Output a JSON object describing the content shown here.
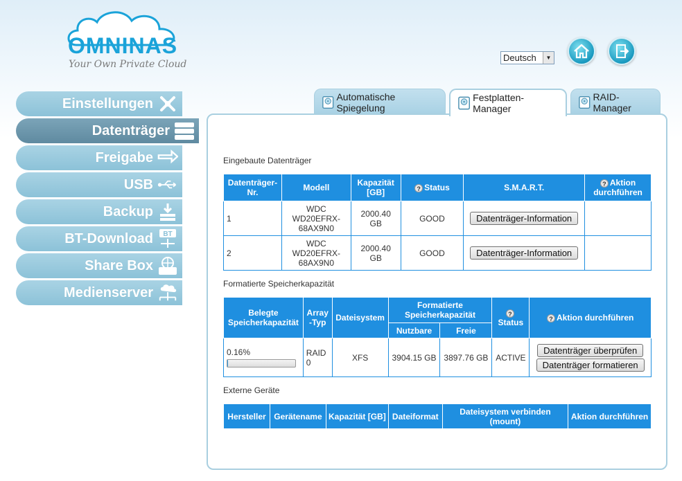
{
  "header": {
    "brand": "OMNINAS",
    "tagline": "Your Own Private Cloud",
    "language": "Deutsch"
  },
  "sidebar": {
    "items": [
      {
        "label": "Einstellungen",
        "icon": "tools-icon"
      },
      {
        "label": "Datenträger",
        "icon": "disk-stack-icon",
        "active": true
      },
      {
        "label": "Freigabe",
        "icon": "share-arrows-icon"
      },
      {
        "label": "USB",
        "icon": "usb-icon"
      },
      {
        "label": "Backup",
        "icon": "backup-icon"
      },
      {
        "label": "BT-Download",
        "icon": "bt-download-icon",
        "badge": "BT"
      },
      {
        "label": "Share Box",
        "icon": "share-box-icon"
      },
      {
        "label": "Medienserver",
        "icon": "media-server-icon"
      }
    ]
  },
  "tabs": [
    {
      "label": "Automatische Spiegelung"
    },
    {
      "label": "Festplatten-Manager",
      "active": true
    },
    {
      "label": "RAID-Manager"
    }
  ],
  "builtin": {
    "title": "Eingebaute Datenträger",
    "headers": {
      "nr": "Datenträger-Nr.",
      "model": "Modell",
      "capacity": "Kapazität [GB]",
      "status": "Status",
      "smart": "S.M.A.R.T.",
      "action": "Aktion durchführen"
    },
    "rows": [
      {
        "nr": "1",
        "model": "WDC WD20EFRX-68AX9N0",
        "capacity": "2000.40 GB",
        "status": "GOOD",
        "smart_button": "Datenträger-Information",
        "action": ""
      },
      {
        "nr": "2",
        "model": "WDC WD20EFRX-68AX9N0",
        "capacity": "2000.40 GB",
        "status": "GOOD",
        "smart_button": "Datenträger-Information",
        "action": ""
      }
    ]
  },
  "formatted": {
    "title": "Formatierte Speicherkapazität",
    "headers": {
      "used": "Belegte Speicherkapazität",
      "array": "Array -Typ",
      "fs": "Dateisystem",
      "formatted": "Formatierte Speicherkapazität",
      "usable": "Nutzbare",
      "free": "Freie",
      "status": "Status",
      "action": "Aktion durchführen"
    },
    "row": {
      "used": "0.16%",
      "used_fraction": 0.0016,
      "array": "RAID 0",
      "fs": "XFS",
      "usable": "3904.15 GB",
      "free": "3897.76 GB",
      "status": "ACTIVE",
      "check_button": "Datenträger überprüfen",
      "format_button": "Datenträger formatieren"
    }
  },
  "external": {
    "title": "Externe Geräte",
    "headers": {
      "vendor": "Hersteller",
      "name": "Gerätename",
      "capacity": "Kapazität [GB]",
      "format": "Dateiformat",
      "mount": "Dateisystem verbinden (mount)",
      "action": "Aktion durchführen"
    }
  },
  "colors": {
    "accent": "#1f8fe0",
    "nav": "#8cc2d8",
    "nav_active": "#5f8aa0"
  }
}
